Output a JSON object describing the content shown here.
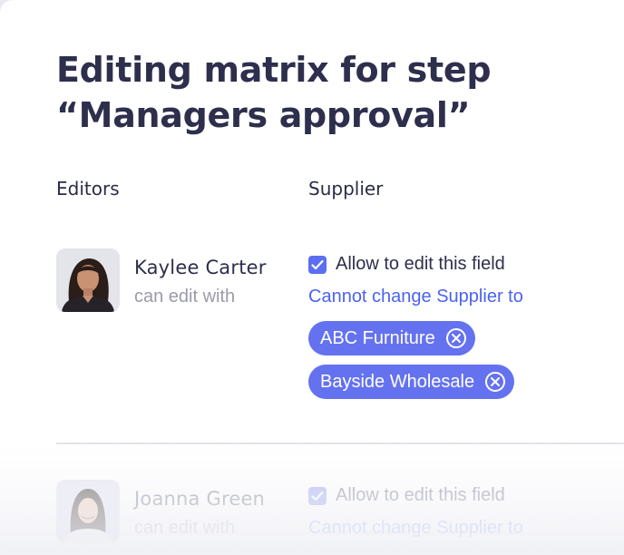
{
  "title_line1": "Editing matrix for step",
  "title_line2": "“Managers approval”",
  "columns": {
    "editors": "Editors",
    "supplier": "Supplier"
  },
  "editors": [
    {
      "name": "Kaylee Carter",
      "subtitle": "can edit with",
      "allow_label": "Allow to edit this field",
      "allow_checked": true,
      "rule": "Cannot change Supplier to",
      "chips": [
        "ABC Furniture",
        "Bayside Wholesale"
      ]
    },
    {
      "name": "Joanna Green",
      "subtitle": "can edit with",
      "allow_label": "Allow to edit this field",
      "allow_checked": true,
      "rule": "Cannot change Supplier to"
    }
  ],
  "icons": {
    "checkbox": "check-icon",
    "chip_remove": "close-circle-icon"
  },
  "colors": {
    "accent": "#5b6ef2",
    "chip": "#6472f0",
    "link": "#4a63f0",
    "title": "#2d2f4c"
  }
}
